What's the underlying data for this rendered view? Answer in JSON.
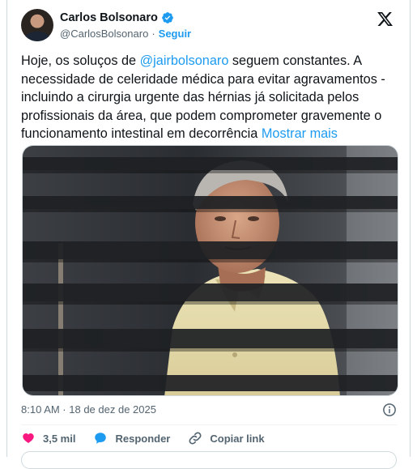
{
  "author": {
    "display_name": "Carlos Bolsonaro",
    "handle": "@CarlosBolsonaro",
    "separator": "·",
    "follow_label": "Seguir"
  },
  "tweet": {
    "text_before": "Hoje, os soluços de ",
    "mention": "@jairbolsonaro",
    "text_after": " seguem constantes. A necessidade de celeridade médica para evitar agravamentos - incluindo a cirurgia urgente das hérnias já solicitada pelos profissionais da área, que podem comprometer gravemente o funcionamento intestinal em decorrência ",
    "show_more": "Mostrar mais"
  },
  "meta": {
    "timestamp": "8:10 AM · 18 de dez de 2025"
  },
  "actions": {
    "like_count": "3,5 mil",
    "reply_label": "Responder",
    "copy_label": "Copiar link"
  },
  "icons": {
    "verified": "verified-badge-icon",
    "x_logo": "x-logo-icon",
    "info": "info-icon",
    "heart": "heart-icon",
    "reply": "reply-bubble-icon",
    "link": "link-icon"
  },
  "colors": {
    "accent": "#1d9bf0",
    "like": "#f91880",
    "text": "#0f1419",
    "secondary": "#536471"
  }
}
